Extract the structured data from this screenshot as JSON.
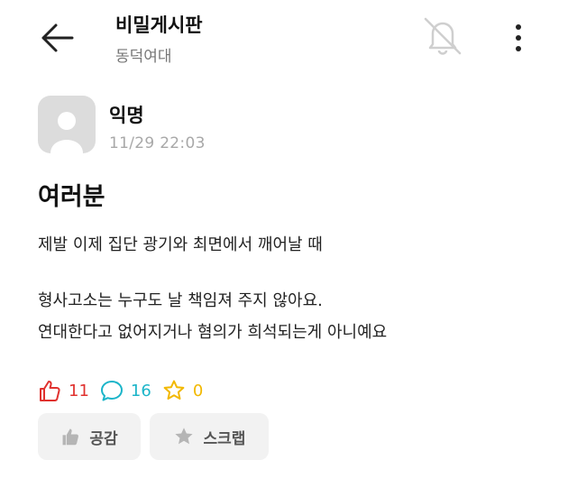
{
  "header": {
    "title": "비밀게시판",
    "subtitle": "동덕여대",
    "icons": {
      "back": "back-arrow-icon",
      "notification": "bell-off-icon",
      "more": "more-vertical-icon"
    }
  },
  "post": {
    "author": "익명",
    "date": "11/29 22:03",
    "title": "여러분",
    "paragraphs": [
      [
        "제발 이제 집단 광기와 최면에서 깨어날 때"
      ],
      [
        "형사고소는 누구도 날 책임져 주지 않아요.",
        "연대한다고 없어지거나 혐의가 희석되는게 아니예요"
      ]
    ],
    "stats": {
      "likes": "11",
      "comments": "16",
      "scraps": "0"
    }
  },
  "actions": {
    "like_label": "공감",
    "scrap_label": "스크랩"
  },
  "colors": {
    "like": "#e0322f",
    "comment": "#1cb5c9",
    "scrap": "#f2b800",
    "subtle_text": "#777777",
    "button_bg": "#f2f2f2"
  }
}
